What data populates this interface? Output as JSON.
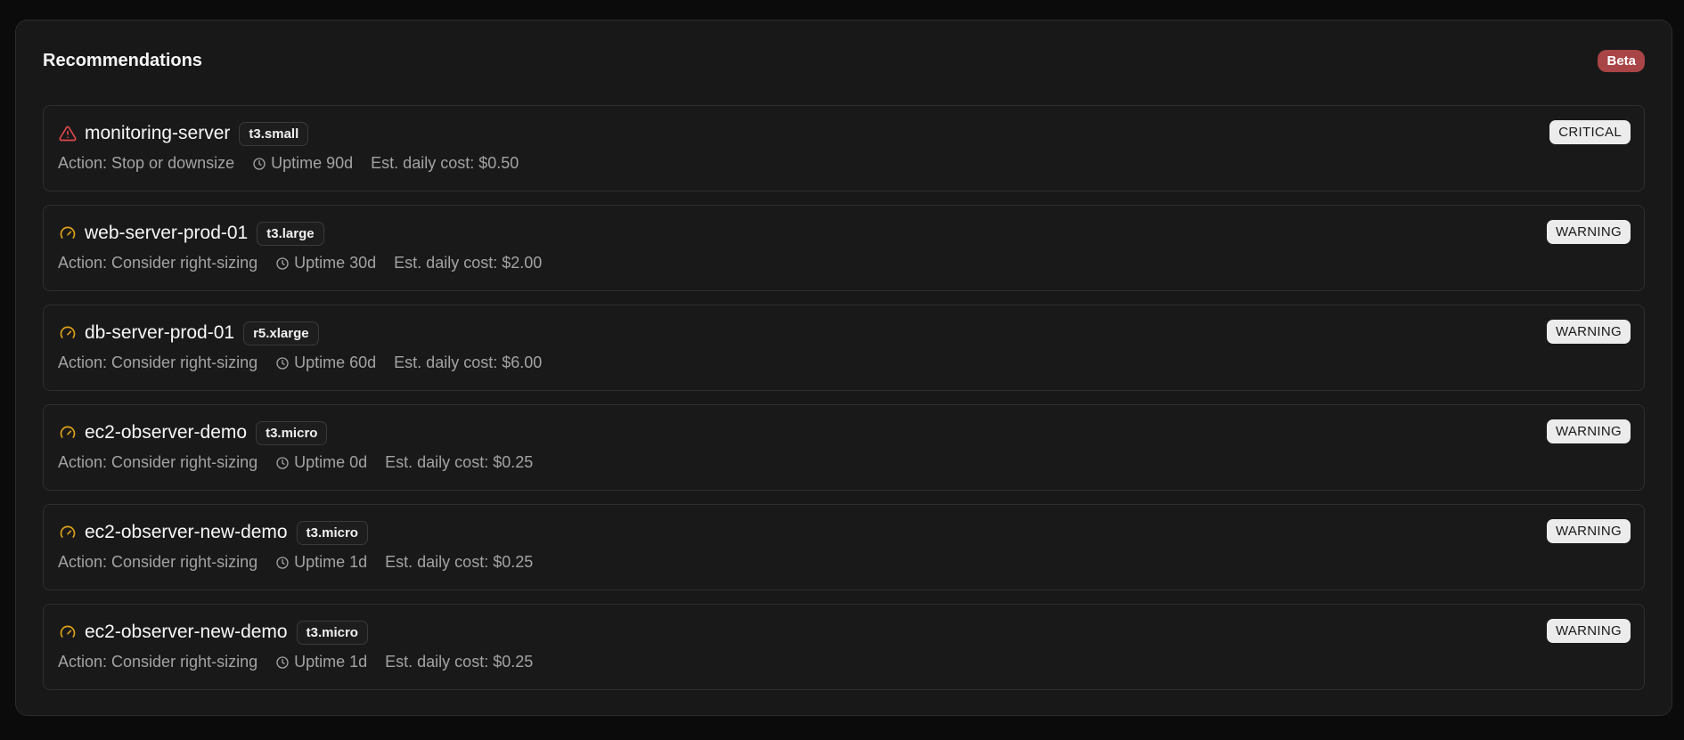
{
  "panel": {
    "title": "Recommendations",
    "badge": "Beta"
  },
  "colors": {
    "critical_icon": "#e0484b",
    "warning_icon": "#e0a21a",
    "beta_badge": "#a94447"
  },
  "recommendations": [
    {
      "icon": "alert-triangle-icon",
      "name": "monitoring-server",
      "instance_type": "t3.small",
      "severity": "CRITICAL",
      "action": "Action: Stop or downsize",
      "uptime": "Uptime 90d",
      "cost": "Est. daily cost: $0.50"
    },
    {
      "icon": "gauge-icon",
      "name": "web-server-prod-01",
      "instance_type": "t3.large",
      "severity": "WARNING",
      "action": "Action: Consider right-sizing",
      "uptime": "Uptime 30d",
      "cost": "Est. daily cost: $2.00"
    },
    {
      "icon": "gauge-icon",
      "name": "db-server-prod-01",
      "instance_type": "r5.xlarge",
      "severity": "WARNING",
      "action": "Action: Consider right-sizing",
      "uptime": "Uptime 60d",
      "cost": "Est. daily cost: $6.00"
    },
    {
      "icon": "gauge-icon",
      "name": "ec2-observer-demo",
      "instance_type": "t3.micro",
      "severity": "WARNING",
      "action": "Action: Consider right-sizing",
      "uptime": "Uptime 0d",
      "cost": "Est. daily cost: $0.25"
    },
    {
      "icon": "gauge-icon",
      "name": "ec2-observer-new-demo",
      "instance_type": "t3.micro",
      "severity": "WARNING",
      "action": "Action: Consider right-sizing",
      "uptime": "Uptime 1d",
      "cost": "Est. daily cost: $0.25"
    },
    {
      "icon": "gauge-icon",
      "name": "ec2-observer-new-demo",
      "instance_type": "t3.micro",
      "severity": "WARNING",
      "action": "Action: Consider right-sizing",
      "uptime": "Uptime 1d",
      "cost": "Est. daily cost: $0.25"
    }
  ]
}
